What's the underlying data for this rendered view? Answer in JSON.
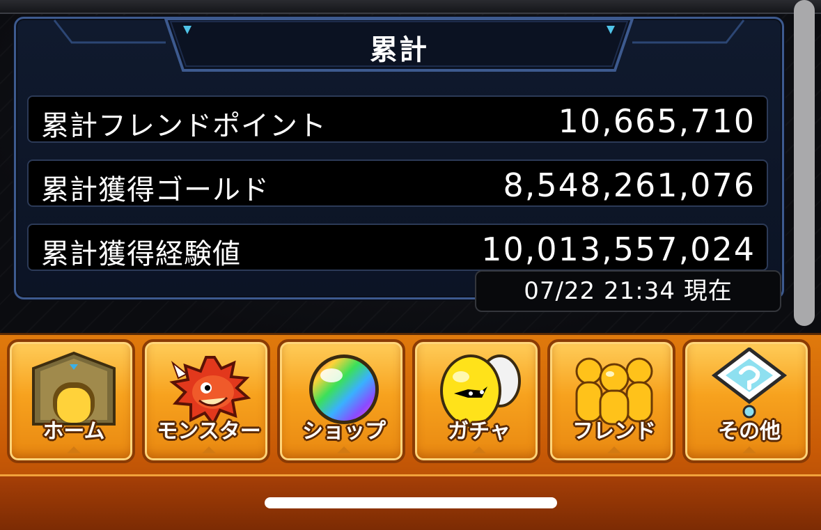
{
  "panel": {
    "title": "累計",
    "rows": [
      {
        "label": "累計フレンドポイント",
        "value": "10,665,710"
      },
      {
        "label": "累計獲得ゴールド",
        "value": "8,548,261,076"
      },
      {
        "label": "累計獲得経験値",
        "value": "10,013,557,024"
      }
    ],
    "timestamp": "07/22 21:34 現在"
  },
  "nav": {
    "items": [
      {
        "label": "ホーム",
        "icon": "home-gate-icon"
      },
      {
        "label": "モンスター",
        "icon": "monster-dragon-icon"
      },
      {
        "label": "ショップ",
        "icon": "rainbow-orb-icon"
      },
      {
        "label": "ガチャ",
        "icon": "egg-gacha-icon"
      },
      {
        "label": "フレンド",
        "icon": "friends-icon"
      },
      {
        "label": "その他",
        "icon": "other-sign-icon"
      }
    ]
  },
  "colors": {
    "panel_border": "#3d5a8f",
    "nav_orange": "#f7a21e",
    "nav_dark": "#8a3b05"
  }
}
